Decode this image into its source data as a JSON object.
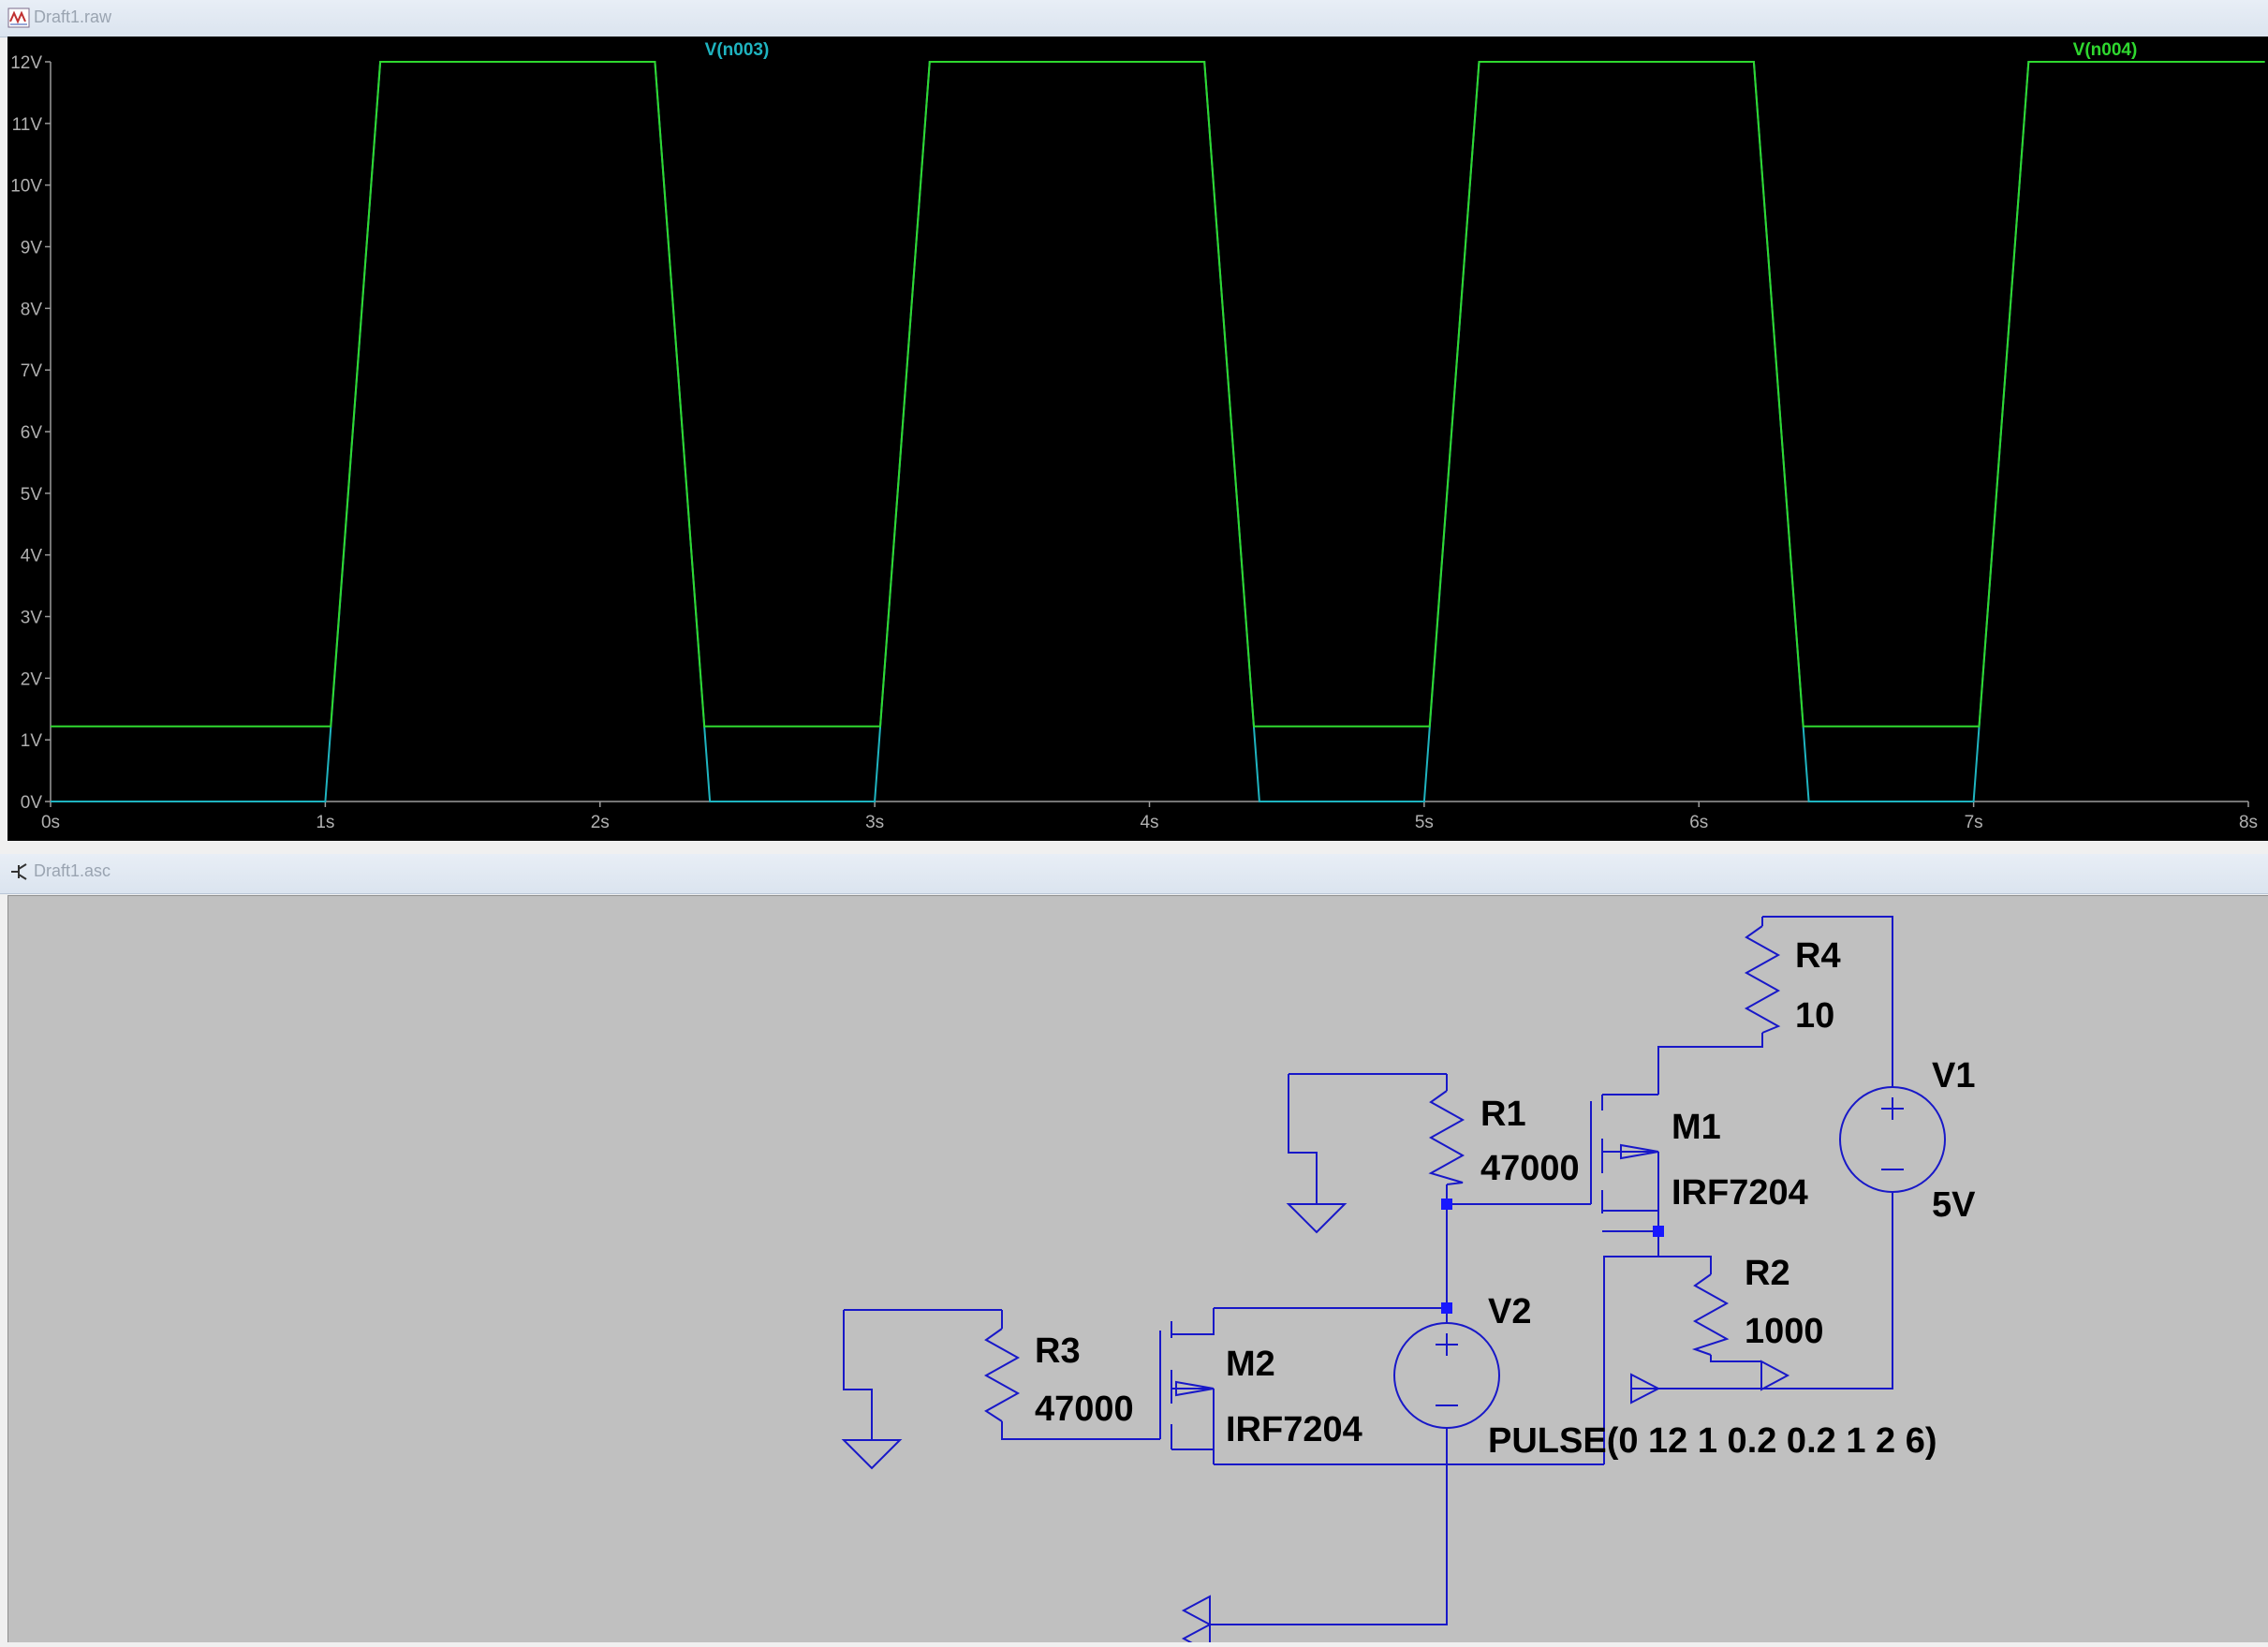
{
  "waveform_window": {
    "title": "Draft1.raw",
    "icon": "waveform-window-icon"
  },
  "schematic_window": {
    "title": "Draft1.asc",
    "icon": "schematic-window-icon"
  },
  "chart_data": {
    "type": "line",
    "title": "",
    "xlabel": "",
    "ylabel": "",
    "xlim": [
      0,
      8
    ],
    "ylim": [
      0,
      12
    ],
    "x_ticks": [
      "0s",
      "1s",
      "2s",
      "3s",
      "4s",
      "5s",
      "6s",
      "7s",
      "8s"
    ],
    "y_ticks": [
      "0V",
      "1V",
      "2V",
      "3V",
      "4V",
      "5V",
      "6V",
      "7V",
      "8V",
      "9V",
      "10V",
      "11V",
      "12V"
    ],
    "background": "#000000",
    "grid": false,
    "legend": "top",
    "series": [
      {
        "name": "V(n003)",
        "color": "#1fb4c0",
        "x": [
          0,
          1,
          1.2,
          2.2,
          2.4,
          2.7,
          3,
          3.2,
          4.2,
          4.4,
          5,
          5.2,
          6.2,
          6.4,
          7,
          7.2,
          8.06
        ],
        "y": [
          0,
          0,
          12,
          12,
          0,
          0,
          0,
          12,
          12,
          0,
          0,
          12,
          12,
          0,
          0,
          12,
          12
        ]
      },
      {
        "name": "V(n004)",
        "color": "#2fd82f",
        "x": [
          0,
          1.02,
          1.2,
          2.2,
          2.38,
          3.02,
          3.2,
          4.2,
          4.38,
          5.02,
          5.2,
          6.2,
          6.38,
          7.02,
          7.2,
          8.06
        ],
        "y": [
          1.22,
          1.22,
          12,
          12,
          1.22,
          1.22,
          12,
          12,
          1.22,
          1.22,
          12,
          12,
          1.22,
          1.22,
          12,
          12
        ]
      }
    ]
  },
  "schematic": {
    "wire_color": "#1818c8",
    "components": [
      {
        "ref": "R4",
        "value": "10"
      },
      {
        "ref": "V1",
        "value": "5V"
      },
      {
        "ref": "R1",
        "value": "47000"
      },
      {
        "ref": "M1",
        "value": "IRF7204"
      },
      {
        "ref": "R2",
        "value": "1000"
      },
      {
        "ref": "V2",
        "value": "PULSE(0 12 1 0.2 0.2 1 2 6)"
      },
      {
        "ref": "R3",
        "value": "47000"
      },
      {
        "ref": "M2",
        "value": "IRF7204"
      }
    ]
  }
}
